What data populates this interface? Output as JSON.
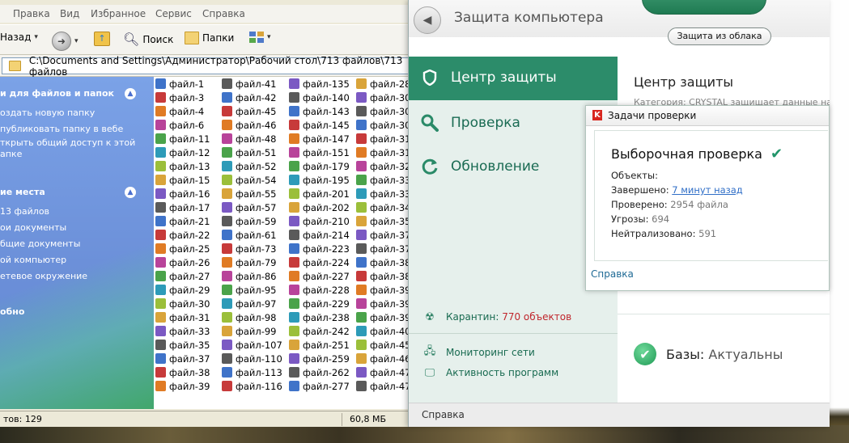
{
  "explorer": {
    "menu": [
      "Правка",
      "Вид",
      "Избранное",
      "Сервис",
      "Справка"
    ],
    "toolbar": {
      "back": "Назад",
      "search": "Поиск",
      "folders": "Папки"
    },
    "address": "C:\\Documents and Settings\\Администратор\\Рабочий стол\\713 файлов\\713 файлов",
    "tasks": {
      "files_title": "и для файлов и папок",
      "files_items": [
        "оздать новую папку",
        "публиковать папку в вебе",
        "ткрыть общий доступ к этой",
        "апке"
      ],
      "places_title": "ие места",
      "places_items": [
        "13 файлов",
        "ои документы",
        "бщие документы",
        "ой компьютер",
        "етевое окружение"
      ],
      "details_title": "обно"
    },
    "columns": [
      [
        "файл-1",
        "файл-3",
        "файл-4",
        "файл-6",
        "файл-11",
        "файл-12",
        "файл-13",
        "файл-15",
        "файл-16",
        "файл-17",
        "файл-21",
        "файл-22",
        "файл-25",
        "файл-26",
        "файл-27",
        "файл-29",
        "файл-30",
        "файл-31",
        "файл-33",
        "файл-35",
        "файл-37",
        "файл-38",
        "файл-39"
      ],
      [
        "файл-41",
        "файл-42",
        "файл-45",
        "файл-46",
        "файл-48",
        "файл-51",
        "файл-52",
        "файл-54",
        "файл-55",
        "файл-57",
        "файл-59",
        "файл-61",
        "файл-73",
        "файл-79",
        "файл-86",
        "файл-95",
        "файл-97",
        "файл-98",
        "файл-99",
        "файл-107",
        "файл-110",
        "файл-113",
        "файл-116"
      ],
      [
        "файл-135",
        "файл-140",
        "файл-143",
        "файл-145",
        "файл-147",
        "файл-151",
        "файл-179",
        "файл-195",
        "файл-201",
        "файл-202",
        "файл-210",
        "файл-214",
        "файл-223",
        "файл-224",
        "файл-227",
        "файл-228",
        "файл-229",
        "файл-238",
        "файл-242",
        "файл-251",
        "файл-259",
        "файл-262",
        "файл-277"
      ],
      [
        "файл-28",
        "файл-30",
        "файл-30",
        "файл-30",
        "файл-31",
        "файл-31",
        "файл-32",
        "файл-33",
        "файл-33",
        "файл-34",
        "файл-35",
        "файл-37",
        "файл-37",
        "файл-38",
        "файл-38",
        "файл-39",
        "файл-39",
        "файл-39",
        "файл-40",
        "файл-45",
        "файл-46",
        "файл-47",
        "файл-47"
      ]
    ],
    "status": {
      "objects": "тов: 129",
      "size": "60,8 МБ"
    }
  },
  "kav": {
    "title": "Защита компьютера",
    "cloud_button": "Защита из облака",
    "nav": [
      {
        "label": "Центр защиты",
        "icon": "shield-icon"
      },
      {
        "label": "Проверка",
        "icon": "magnifier-icon"
      },
      {
        "label": "Обновление",
        "icon": "refresh-icon"
      }
    ],
    "quarantine_label": "Карантин:",
    "quarantine_value": "770 объектов",
    "network_monitor": "Мониторинг сети",
    "app_activity": "Активность программ",
    "main_title": "Центр защиты",
    "main_subtitle": "Категория: CRYSTAL защищает данные на ст",
    "bases_label": "Базы:",
    "bases_value": "Актуальны",
    "footer_help": "Справка"
  },
  "popup": {
    "title": "Задачи проверки",
    "scan_title": "Выборочная проверка",
    "objects_label": "Объекты:",
    "finished_label": "Завершено:",
    "finished_value": "7 минут назад",
    "checked_label": "Проверено:",
    "checked_value": "2954 файла",
    "threats_label": "Угрозы:",
    "threats_value": "694",
    "neutralized_label": "Нейтрализовано:",
    "neutralized_value": "591",
    "help": "Справка"
  },
  "colors": {
    "accent_green": "#2c8c6a",
    "quarantine_red": "#c0262c",
    "xp_blue": "#6b8fd8"
  }
}
